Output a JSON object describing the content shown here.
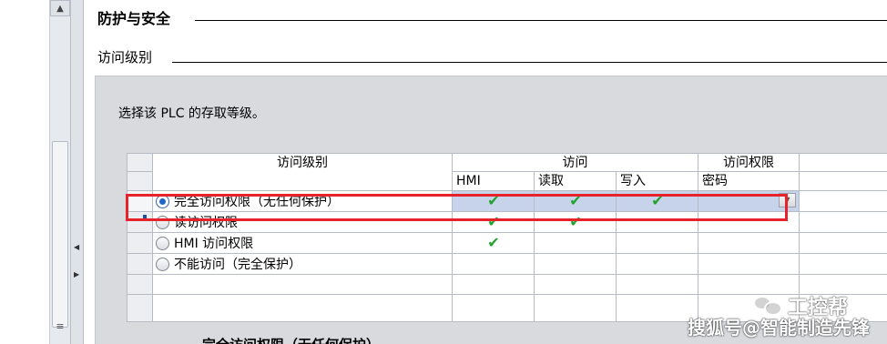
{
  "section": {
    "title": "防护与安全",
    "subtitle": "访问级别"
  },
  "panel": {
    "description": "选择该 PLC 的存取等级。"
  },
  "table": {
    "headers": {
      "level": "访问级别",
      "access": "访问",
      "permission": "访问权限",
      "hmi": "HMI",
      "read": "读取",
      "write": "写入",
      "password": "密码"
    },
    "rows": [
      {
        "label": "完全访问权限（无任何保护）",
        "selected": true,
        "hmi": true,
        "read": true,
        "write": true
      },
      {
        "label": "读访问权限",
        "selected": false,
        "hmi": true,
        "read": true,
        "write": false
      },
      {
        "label": "HMI 访问权限",
        "selected": false,
        "hmi": true,
        "read": false,
        "write": false
      },
      {
        "label": "不能访问（完全保护）",
        "selected": false,
        "hmi": false,
        "read": false,
        "write": false
      }
    ],
    "check_glyph": "✔",
    "check_color": "#22a32f"
  },
  "next_section": {
    "title": "完全访问权限（无任何保护）"
  },
  "watermark": {
    "brand": "工控帮",
    "source": "搜狐号@智能制造先锋"
  },
  "colors": {
    "highlight": "#e8222b",
    "selected_row": "#c7d3ea",
    "panel": "#d8dade"
  }
}
